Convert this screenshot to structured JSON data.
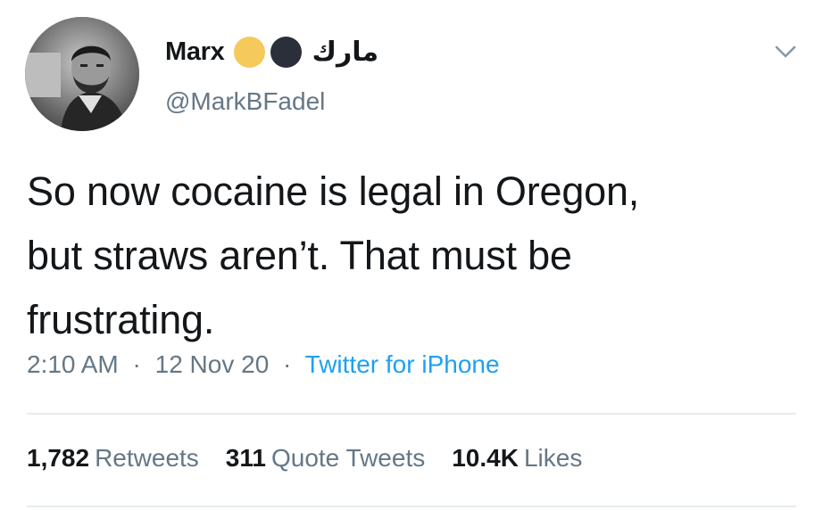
{
  "user": {
    "display_name": "Marx",
    "arabic_name": "مارك",
    "handle": "@MarkBFadel",
    "emoji_colors": [
      "#f5c95c",
      "#2a2f3a"
    ]
  },
  "tweet": {
    "lines": [
      "So now cocaine is legal in Oregon,",
      "but straws aren’t. That must be",
      "frustrating."
    ]
  },
  "meta": {
    "time": "2:10 AM",
    "separator": "·",
    "date": "12 Nov 20",
    "source": "Twitter for iPhone"
  },
  "stats": [
    {
      "count": "1,782",
      "label": "Retweets"
    },
    {
      "count": "311",
      "label": "Quote Tweets"
    },
    {
      "count": "10.4K",
      "label": "Likes"
    }
  ],
  "icons": {
    "menu": "chevron-down-icon",
    "status": [
      "yellow-circle-icon",
      "black-circle-icon"
    ]
  },
  "colors": {
    "text": "#14171a",
    "secondary": "#657786",
    "link": "#1da1f2",
    "divider": "#e6ecf0"
  }
}
